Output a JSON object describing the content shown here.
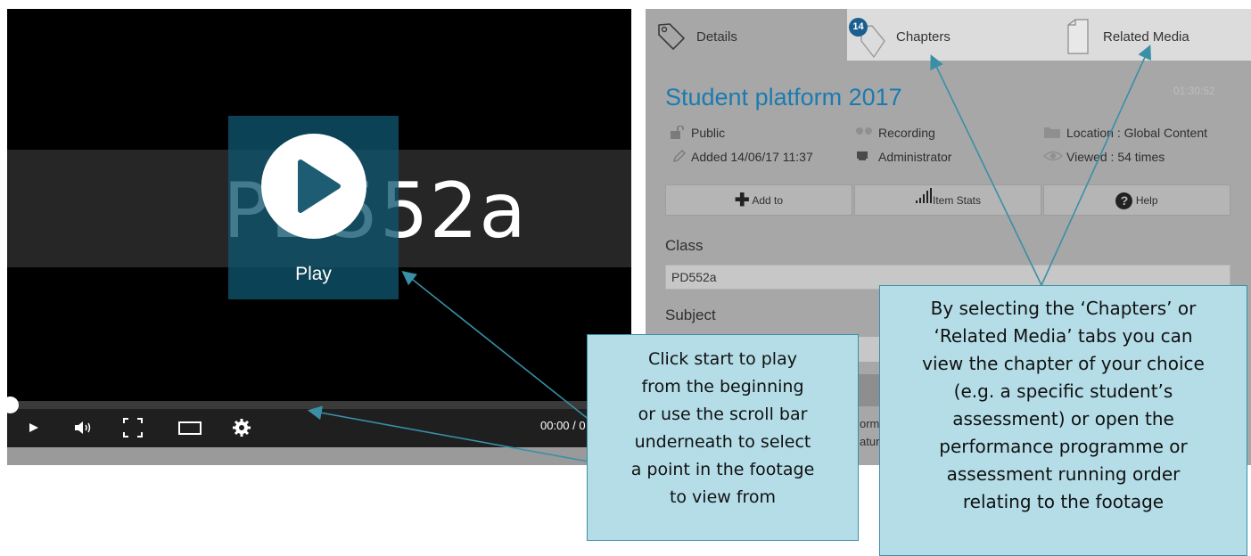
{
  "player": {
    "title_card": "PD552a",
    "play_label": "Play",
    "time": "00:00 / 0",
    "controls": [
      "play-icon",
      "volume-icon",
      "fullscreen-icon",
      "theater-mode-icon",
      "settings-icon"
    ]
  },
  "tabs": [
    {
      "label": "Details",
      "icon": "tag-icon"
    },
    {
      "label": "Chapters",
      "icon": "tag-icon",
      "badge": "14"
    },
    {
      "label": "Related Media",
      "icon": "document-icon"
    }
  ],
  "details": {
    "title": "Student platform 2017",
    "duration": "01:30:52",
    "meta": {
      "visibility": "Public",
      "type": "Recording",
      "location": "Location : Global Content",
      "added": "Added 14/06/17 11:37",
      "owner": "Administrator",
      "viewed": "Viewed : 54 times"
    },
    "buttons": {
      "add_to": "Add to",
      "item_stats": "Item Stats",
      "help": "Help"
    },
    "class_label": "Class",
    "class_value": "PD552a",
    "subject_label": "Subject",
    "peek_1": "orm",
    "peek_2": "atur"
  },
  "callouts": {
    "play": [
      "Click start to play",
      "from the beginning",
      "or use the scroll bar",
      "underneath to select",
      "a point in the footage",
      "to view from"
    ],
    "tabs": [
      "By selecting the ‘Chapters’ or",
      "‘Related Media’ tabs you can",
      "view the chapter of your choice",
      "(e.g. a specific student’s",
      "assessment) or open the",
      "performance programme or",
      "assessment running order",
      "relating to the footage"
    ]
  },
  "colors": {
    "accent": "#1b7bb0",
    "callout_fill": "#b4dde8",
    "callout_border": "#3a8fa7",
    "overlay": "#10546e"
  }
}
